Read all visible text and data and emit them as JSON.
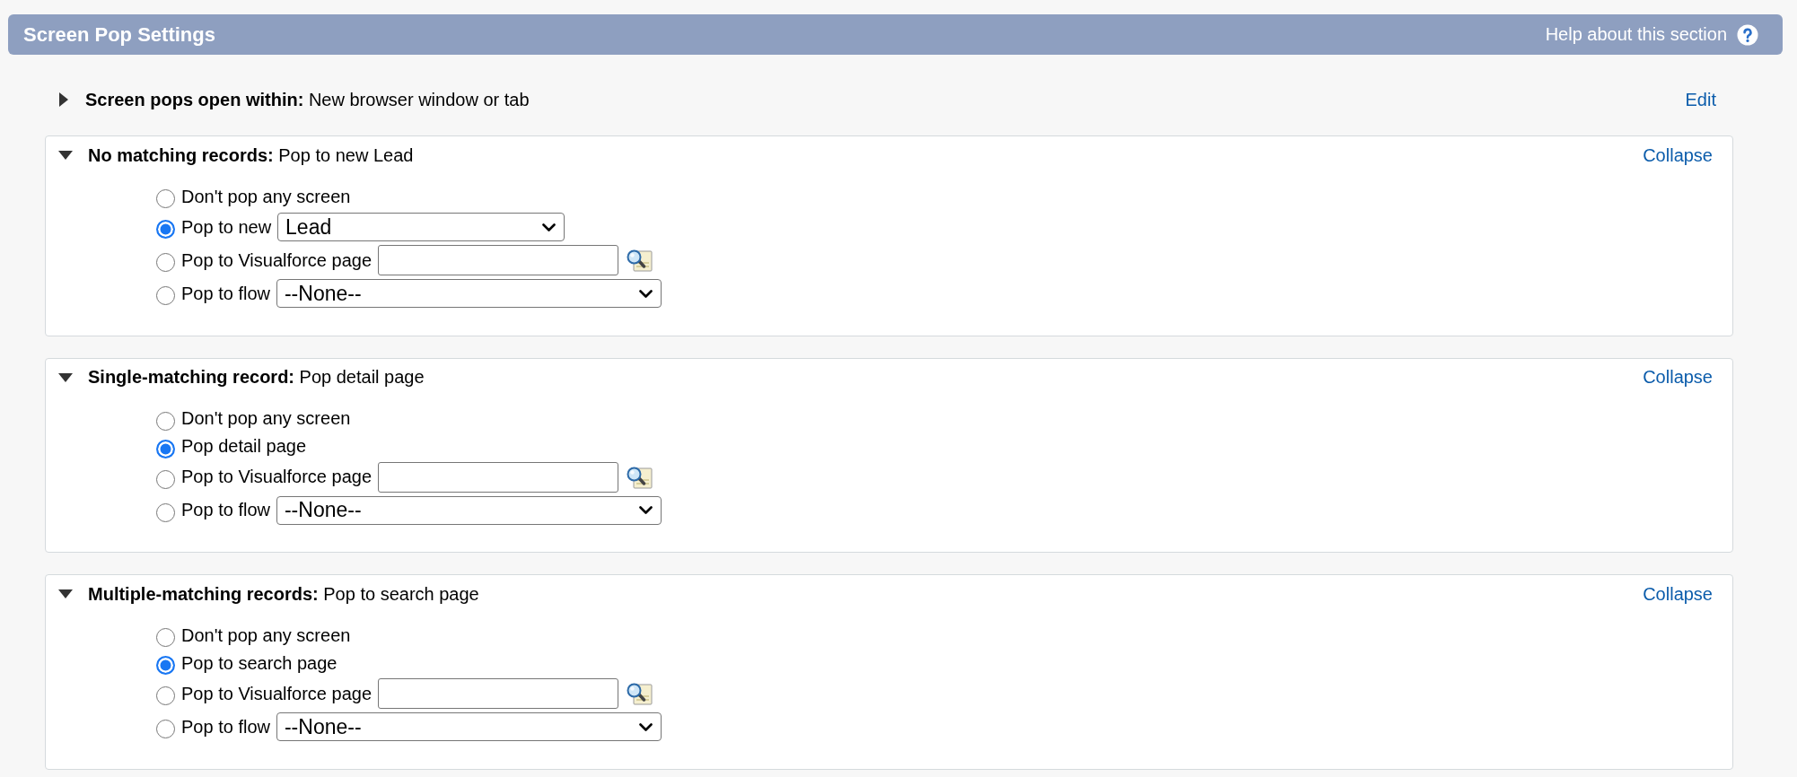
{
  "header": {
    "title": "Screen Pop Settings",
    "help_link": "Help about this section"
  },
  "open_within": {
    "label": "Screen pops open within:",
    "value": "New browser window or tab",
    "expanded": false,
    "action": "Edit"
  },
  "sections": [
    {
      "label": "No matching records:",
      "value": "Pop to new Lead",
      "expanded": true,
      "action": "Collapse",
      "options": [
        {
          "kind": "plain",
          "label": "Don't pop any screen",
          "selected": false
        },
        {
          "kind": "record_select",
          "label": "Pop to new",
          "selected": true,
          "value": "Lead"
        },
        {
          "kind": "lookup",
          "label": "Pop to Visualforce page",
          "selected": false
        },
        {
          "kind": "flow_select",
          "label": "Pop to flow",
          "selected": false,
          "value": "--None--"
        }
      ]
    },
    {
      "label": "Single-matching record:",
      "value": "Pop detail page",
      "expanded": true,
      "action": "Collapse",
      "options": [
        {
          "kind": "plain",
          "label": "Don't pop any screen",
          "selected": false
        },
        {
          "kind": "plain",
          "label": "Pop detail page",
          "selected": true
        },
        {
          "kind": "lookup",
          "label": "Pop to Visualforce page",
          "selected": false
        },
        {
          "kind": "flow_select",
          "label": "Pop to flow",
          "selected": false,
          "value": "--None--"
        }
      ]
    },
    {
      "label": "Multiple-matching records:",
      "value": "Pop to search page",
      "expanded": true,
      "action": "Collapse",
      "options": [
        {
          "kind": "plain",
          "label": "Don't pop any screen",
          "selected": false
        },
        {
          "kind": "plain",
          "label": "Pop to search page",
          "selected": true
        },
        {
          "kind": "lookup",
          "label": "Pop to Visualforce page",
          "selected": false
        },
        {
          "kind": "flow_select",
          "label": "Pop to flow",
          "selected": false,
          "value": "--None--"
        }
      ]
    }
  ]
}
